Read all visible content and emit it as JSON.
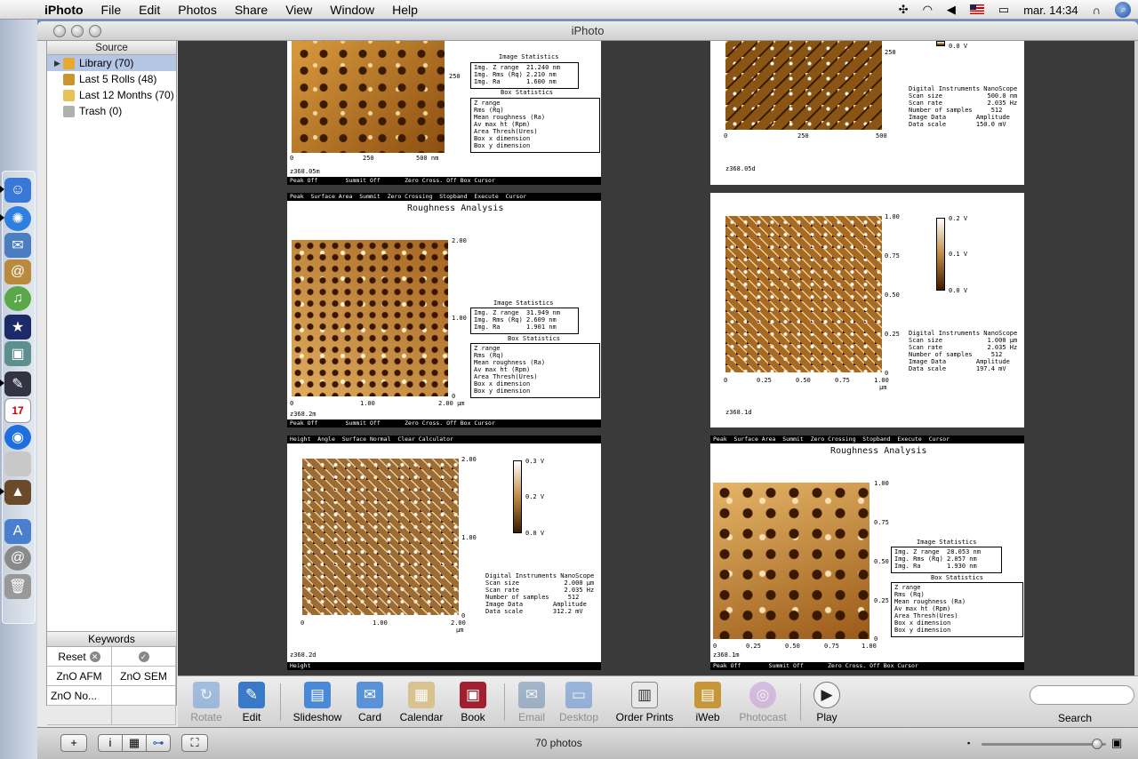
{
  "menubar": {
    "app": "iPhoto",
    "items": [
      "File",
      "Edit",
      "Photos",
      "Share",
      "View",
      "Window",
      "Help"
    ],
    "clock": "mar. 14:34"
  },
  "window": {
    "title": "iPhoto"
  },
  "source": {
    "header": "Source",
    "items": [
      {
        "label": "Library (70)"
      },
      {
        "label": "Last 5 Rolls (48)"
      },
      {
        "label": "Last 12 Months (70)"
      },
      {
        "label": "Trash (0)"
      }
    ]
  },
  "keywords": {
    "header": "Keywords",
    "reset": "Reset",
    "tags": [
      "ZnO AFM",
      "ZnO SEM",
      "ZnO No..."
    ]
  },
  "photos": {
    "p1": {
      "tick_right": "250",
      "x_ticks": [
        "0",
        "250",
        "500 nm"
      ],
      "stat_head": "Image Statistics",
      "stats": "Img. Z range  21.240 nm\nImg. Rms (Rq) 2.210 nm\nImg. Ra       1.600 nm",
      "box_head": "Box Statistics",
      "box": "Z range\nRms (Rq)\nMean roughness (Ra)\nAv max ht (Rpm)\nArea Thresh(Ures)\nBox x dimension\nBox y dimension",
      "label": "z368.05m",
      "footer": "Peak Off        Summit Off       Zero Cross. Off Box Cursor"
    },
    "p2": {
      "top_val": "0.0 V",
      "tick_right": "250",
      "x_ticks": [
        "0",
        "250",
        "500"
      ],
      "info": "Digital Instruments NanoScope\nScan size            500.0 nm\nScan rate            2.035 Hz\nNumber of samples     512\nImage Data        Amplitude\nData scale        150.0 mV",
      "label": "z368.05d"
    },
    "p3": {
      "menu": "Peak  Surface Area  Summit  Zero Crossing  Stopband  Execute  Cursor",
      "title": "Roughness Analysis",
      "y_ticks": [
        "2.00",
        "1.00",
        "0"
      ],
      "x_ticks": [
        "0",
        "1.00",
        "2.00 µm"
      ],
      "stat_head": "Image Statistics",
      "stats": "Img. Z range  31.949 nm\nImg. Rms (Rq) 2.609 nm\nImg. Ra       1.901 nm",
      "box_head": "Box Statistics",
      "box": "Z range\nRms (Rq)\nMean roughness (Ra)\nAv max ht (Rpm)\nArea Thresh(Ures)\nBox x dimension\nBox y dimension",
      "label": "z368.2m",
      "footer": "Peak Off        Summit Off       Zero Cross. Off Box Cursor"
    },
    "p4": {
      "y_ticks": [
        "1.00",
        "0.75",
        "0.50",
        "0.25",
        "0"
      ],
      "x_ticks": [
        "0",
        "0.25",
        "0.50",
        "0.75",
        "1.00"
      ],
      "unit": "µm",
      "cbar": [
        "0.2 V",
        "0.1 V",
        "0.0 V"
      ],
      "info": "Digital Instruments NanoScope\nScan size            1.000 µm\nScan rate            2.035 Hz\nNumber of samples     512\nImage Data        Amplitude\nData scale        197.4 mV",
      "label": "z368.1d"
    },
    "p5": {
      "menu": "Height  Angle  Surface Normal  Clear Calculator",
      "y_ticks": [
        "2.00",
        "1.00",
        "0"
      ],
      "x_ticks": [
        "0",
        "1.00",
        "2.00"
      ],
      "unit": "µm",
      "cbar": [
        "0.3 V",
        "0.2 V",
        "0.0 V"
      ],
      "info": "Digital Instruments NanoScope\nScan size            2.000 µm\nScan rate            2.035 Hz\nNumber of samples     512\nImage Data        Amplitude\nData scale        312.2 mV",
      "label": "z368.2d",
      "footer": "Height"
    },
    "p6": {
      "menu": "Peak  Surface Area  Summit  Zero Crossing  Stopband  Execute  Cursor",
      "title": "Roughness Analysis",
      "y_ticks": [
        "1.00",
        "0.75",
        "0.50",
        "0.25",
        "0"
      ],
      "x_ticks": [
        "0",
        "0.25",
        "0.50",
        "0.75",
        "1.00"
      ],
      "unit": "µm",
      "stat_head": "Image Statistics",
      "stats": "Img. Z range  28.053 nm\nImg. Rms (Rq) 2.057 nm\nImg. Ra       1.930 nm",
      "box_head": "Box Statistics",
      "box": "Z range\nRms (Rq)\nMean roughness (Ra)\nAv max ht (Rpm)\nArea Thresh(Ures)\nBox x dimension\nBox y dimension",
      "label": "z368.1m",
      "footer": "Peak Off        Summit Off       Zero Cross. Off Box Cursor"
    }
  },
  "toolbar": {
    "rotate": "Rotate",
    "edit": "Edit",
    "slideshow": "Slideshow",
    "card": "Card",
    "calendar": "Calendar",
    "book": "Book",
    "email": "Email",
    "desktop": "Desktop",
    "order_prints": "Order Prints",
    "iweb": "iWeb",
    "photocast": "Photocast",
    "play": "Play",
    "search_label": "Search"
  },
  "status": {
    "count": "70 photos"
  },
  "calendar_day": "17",
  "colors": {
    "selection": "#b5c6e4",
    "desktop": "#6f8fc4"
  }
}
